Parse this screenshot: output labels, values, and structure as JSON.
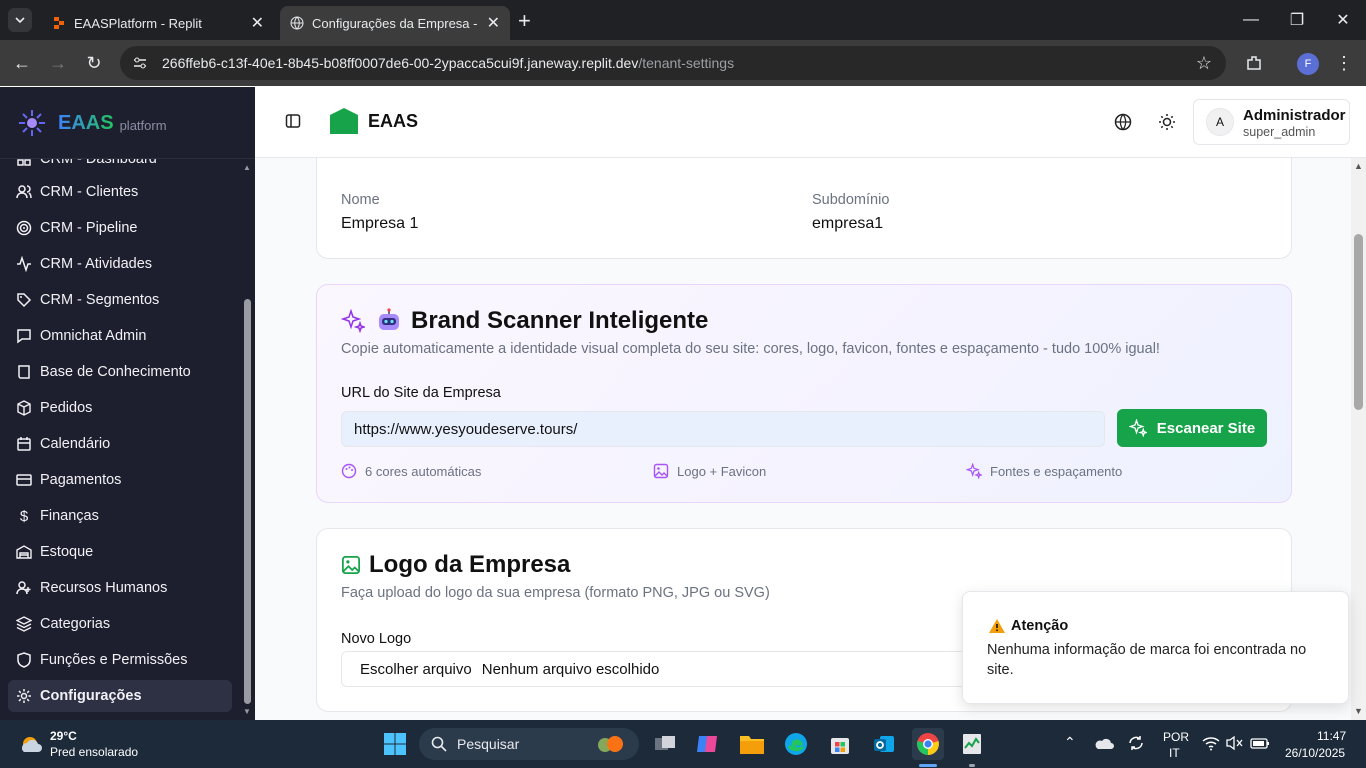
{
  "browser": {
    "tabs": [
      {
        "title": "EAASPlatform - Replit",
        "active": false
      },
      {
        "title": "Configurações da Empresa - EA",
        "active": true
      }
    ],
    "url_host": "266ffeb6-c13f-40e1-8b45-b08ff0007de6-00-2ypacca5cui9f.janeway.replit.dev",
    "url_path": "/tenant-settings",
    "profile_initial": "F"
  },
  "sidebar": {
    "brand": "EAAS",
    "brand_sub": "platform",
    "items": [
      {
        "label": "CRM - Dashboard",
        "icon": "dashboard-icon"
      },
      {
        "label": "CRM - Clientes",
        "icon": "users-icon"
      },
      {
        "label": "CRM - Pipeline",
        "icon": "target-icon"
      },
      {
        "label": "CRM - Atividades",
        "icon": "activity-icon"
      },
      {
        "label": "CRM - Segmentos",
        "icon": "tag-icon"
      },
      {
        "label": "Omnichat Admin",
        "icon": "chat-icon"
      },
      {
        "label": "Base de Conhecimento",
        "icon": "book-icon"
      },
      {
        "label": "Pedidos",
        "icon": "package-icon"
      },
      {
        "label": "Calendário",
        "icon": "calendar-icon"
      },
      {
        "label": "Pagamentos",
        "icon": "card-icon"
      },
      {
        "label": "Finanças",
        "icon": "dollar-icon"
      },
      {
        "label": "Estoque",
        "icon": "warehouse-icon"
      },
      {
        "label": "Recursos Humanos",
        "icon": "user-group-icon"
      },
      {
        "label": "Categorias",
        "icon": "layers-icon"
      },
      {
        "label": "Funções e Permissões",
        "icon": "shield-icon"
      },
      {
        "label": "Configurações",
        "icon": "gear-icon",
        "active": true
      }
    ]
  },
  "header": {
    "logo_text": "EAAS",
    "user_initial": "A",
    "user_name": "Administrador",
    "user_role": "super_admin"
  },
  "company": {
    "name_label": "Nome",
    "name_value": "Empresa 1",
    "subdomain_label": "Subdomínio",
    "subdomain_value": "empresa1"
  },
  "scanner": {
    "title": "Brand Scanner Inteligente",
    "description": "Copie automaticamente a identidade visual completa do seu site: cores, logo, favicon, fontes e espaçamento - tudo 100% igual!",
    "url_label": "URL do Site da Empresa",
    "url_value": "https://www.yesyoudeserve.tours/",
    "button_label": "Escanear Site",
    "features": [
      "6 cores automáticas",
      "Logo + Favicon",
      "Fontes e espaçamento"
    ]
  },
  "logo_section": {
    "title": "Logo da Empresa",
    "description": "Faça upload do logo da sua empresa (formato PNG, JPG ou SVG)",
    "field_label": "Novo Logo",
    "file_button": "Escolher arquivo",
    "file_status": "Nenhum arquivo escolhido"
  },
  "toast": {
    "title": "Atenção",
    "message": "Nenhuma informação de marca foi encontrada no site."
  },
  "taskbar": {
    "weather_temp": "29°C",
    "weather_desc": "Pred ensolarado",
    "search_placeholder": "Pesquisar",
    "lang_line1": "POR",
    "lang_line2": "IT",
    "time": "11:47",
    "date": "26/10/2025"
  },
  "colors": {
    "accent_green": "#16a34a",
    "sidebar_bg": "#1e1f2e",
    "scanner_border": "#e9d5ff"
  }
}
